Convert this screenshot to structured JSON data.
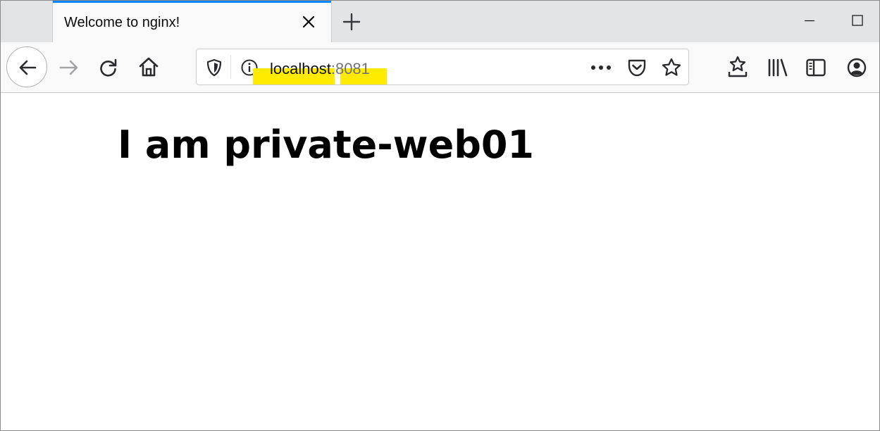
{
  "tab": {
    "title": "Welcome to nginx!",
    "accent_color": "#0a84ff"
  },
  "urlbar": {
    "host": "localhost",
    "port": ":8081",
    "highlight_color": "#ffeb00"
  },
  "toolbar_icons": [
    "back-icon",
    "forward-icon",
    "reload-icon",
    "home-icon",
    "tracking-protection-shield-icon",
    "site-info-icon",
    "page-actions-ellipsis-icon",
    "pocket-icon",
    "bookmark-star-icon",
    "bookmarks-toolbar-star-icon",
    "library-icon",
    "sidebar-icon",
    "account-icon"
  ],
  "page": {
    "heading": "I am private-web01"
  }
}
